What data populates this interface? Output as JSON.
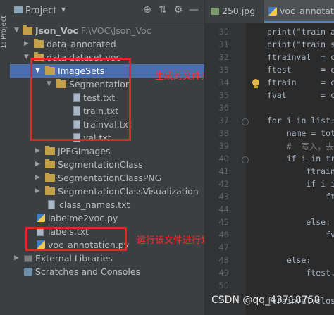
{
  "side_strip": {
    "label": "1: Project"
  },
  "project_panel": {
    "title": "Project",
    "dropdown_arrow": "▾",
    "toolbar_icons": [
      "target-icon",
      "collapse-icon",
      "gear-icon",
      "minimize-icon"
    ],
    "toolbar_glyphs": {
      "locate": "⊕",
      "collapse": "⇅",
      "settings": "⚙",
      "hide": "—"
    },
    "tree": [
      {
        "id": "json_voc",
        "label": "Json_Voc",
        "path": "F:\\VOC\\Json_Voc",
        "expanded": true,
        "icon": "folder-icon"
      },
      {
        "id": "data_annotated",
        "label": "data_annotated",
        "expanded": false,
        "icon": "folder-icon"
      },
      {
        "id": "data_dataset_voc",
        "label": "data dataset voc",
        "expanded": true,
        "icon": "folder-icon"
      },
      {
        "id": "imagesets",
        "label": "ImageSets",
        "expanded": true,
        "selected": true,
        "icon": "folder-icon"
      },
      {
        "id": "segmentation",
        "label": "Segmentation",
        "expanded": true,
        "icon": "folder-icon"
      },
      {
        "id": "test_txt",
        "label": "test.txt",
        "icon": "text-file-icon"
      },
      {
        "id": "train_txt",
        "label": "train.txt",
        "icon": "text-file-icon"
      },
      {
        "id": "trainval_txt",
        "label": "trainval.txt",
        "icon": "text-file-icon"
      },
      {
        "id": "val_txt",
        "label": "val.txt",
        "icon": "text-file-icon"
      },
      {
        "id": "jpegimages",
        "label": "JPEGImages",
        "expanded": false,
        "icon": "folder-icon"
      },
      {
        "id": "segclass",
        "label": "SegmentationClass",
        "expanded": false,
        "icon": "folder-icon"
      },
      {
        "id": "segclasspng",
        "label": "SegmentationClassPNG",
        "expanded": false,
        "icon": "folder-icon"
      },
      {
        "id": "segclassvis",
        "label": "SegmentationClassVisualization",
        "expanded": false,
        "icon": "folder-icon"
      },
      {
        "id": "class_names",
        "label": "class_names.txt",
        "icon": "text-file-icon"
      },
      {
        "id": "labelme2voc",
        "label": "labelme2voc.py",
        "icon": "python-file-icon"
      },
      {
        "id": "labels_txt",
        "label": "labels.txt",
        "icon": "text-file-icon"
      },
      {
        "id": "voc_annotation",
        "label": "voc_annotation.py",
        "icon": "python-file-icon"
      },
      {
        "id": "external_libs",
        "label": "External Libraries",
        "expanded": false,
        "icon": "library-icon"
      },
      {
        "id": "scratches",
        "label": "Scratches and Consoles",
        "icon": "scratches-icon"
      }
    ]
  },
  "annotations": {
    "generated_folder_note": "生成的文件夹以及txt文件",
    "run_note": "运行该文件进行划分"
  },
  "editor": {
    "tabs": [
      {
        "label": "250.jpg",
        "icon": "image-file-icon",
        "active": false
      },
      {
        "label": "voc_annotatio",
        "icon": "python-file-icon",
        "active": true
      }
    ],
    "line_numbers": [
      "30",
      "31",
      "32",
      "33",
      "34",
      "35",
      "36",
      "37",
      "38",
      "39",
      "40",
      "41",
      "42",
      "43",
      "44",
      "45",
      "46",
      "47",
      "48",
      "49",
      "50",
      "51"
    ],
    "code_lines": [
      "",
      "print(\"train an",
      "print(\"train si",
      "ftrainval  = c",
      "ftest      = c",
      "ftrain     = c",
      "fval       = c",
      "",
      "for i in list:",
      "    name = tota",
      "    #  写入，去",
      "    if i in tra",
      "        ftrainv",
      "        if i in",
      "            ftr",
      "",
      "        else:",
      "            fva",
      "",
      "    else:",
      "        ftest.w",
      "ftrainval.close"
    ]
  },
  "watermark": "CSDN @qq_43718758"
}
